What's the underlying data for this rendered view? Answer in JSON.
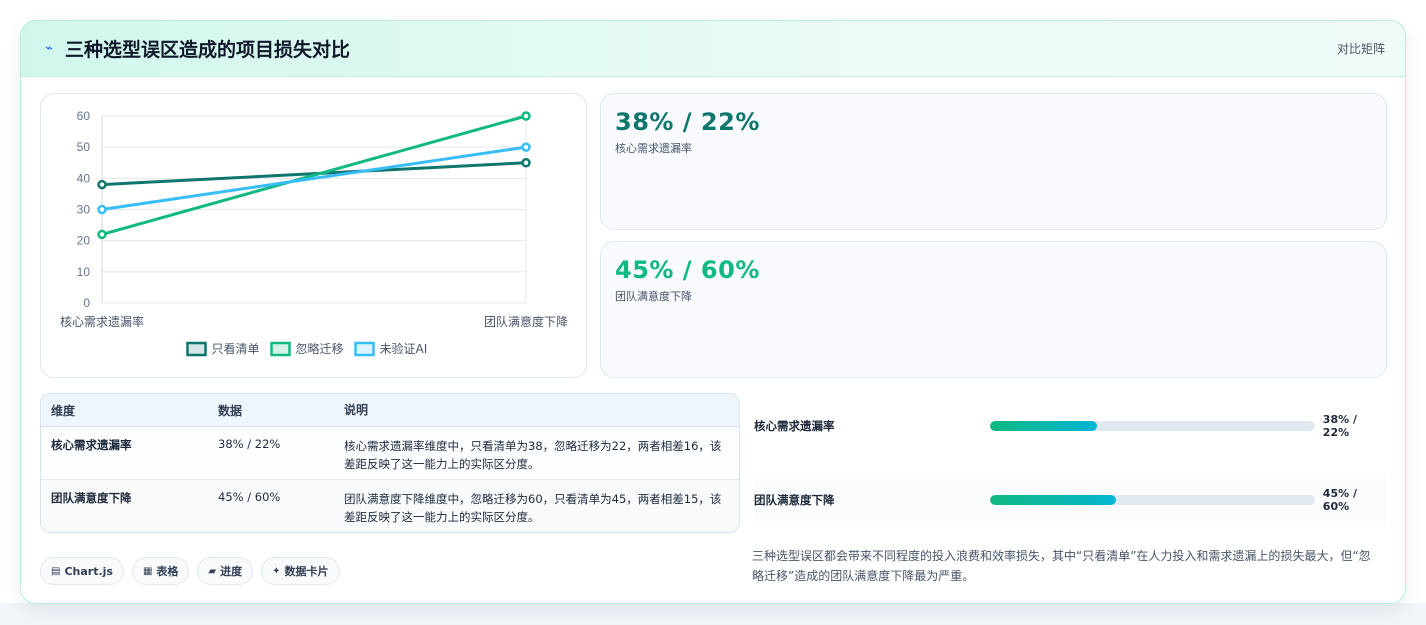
{
  "header": {
    "icon": "lightning-icon",
    "title": "三种选型误区造成的项目损失对比",
    "tag": "对比矩阵"
  },
  "chart_data": {
    "type": "line",
    "categories": [
      "核心需求遗漏率",
      "团队满意度下降"
    ],
    "series": [
      {
        "name": "只看清单",
        "values": [
          38,
          45
        ],
        "color": "#0f766e"
      },
      {
        "name": "忽略迁移",
        "values": [
          22,
          60
        ],
        "color": "#10b981"
      },
      {
        "name": "未验证AI",
        "values": [
          30,
          50
        ],
        "color": "#38bdf8"
      }
    ],
    "ylim": [
      0,
      60
    ],
    "yticks": [
      "0",
      "10",
      "20",
      "30",
      "40",
      "50",
      "60"
    ],
    "grid": true,
    "legend": "bottom"
  },
  "stats": [
    {
      "value": "38% / 22%",
      "label": "核心需求遗漏率"
    },
    {
      "value": "45% / 60%",
      "label": "团队满意度下降"
    }
  ],
  "table": {
    "headers": [
      "维度",
      "数据",
      "说明"
    ],
    "rows": [
      {
        "dimension": "核心需求遗漏率",
        "data": "38% / 22%",
        "note": "核心需求遗漏率维度中，只看清单为38，忽略迁移为22，两者相差16，该差距反映了这一能力上的实际区分度。"
      },
      {
        "dimension": "团队满意度下降",
        "data": "45% / 60%",
        "note": "团队满意度下降维度中，忽略迁移为60，只看清单为45，两者相差15，该差距反映了这一能力上的实际区分度。"
      }
    ]
  },
  "progress": [
    {
      "label": "核心需求遗漏率",
      "value": "38% / 22%",
      "fill": 0.33
    },
    {
      "label": "团队满意度下降",
      "value": "45% / 60%",
      "fill": 0.39
    }
  ],
  "tags": [
    {
      "icon": "chart-icon",
      "glyph": "▤",
      "label": "Chart.js"
    },
    {
      "icon": "table-icon",
      "glyph": "▦",
      "label": "表格"
    },
    {
      "icon": "progress-icon",
      "glyph": "▰",
      "label": "进度"
    },
    {
      "icon": "sparkle-icon",
      "glyph": "✦",
      "label": "数据卡片"
    }
  ],
  "summary": "三种选型误区都会带来不同程度的投入浪费和效率损失，其中“只看清单”在人力投入和需求遗漏上的损失最大，但“忽略迁移”造成的团队满意度下降最为严重。"
}
